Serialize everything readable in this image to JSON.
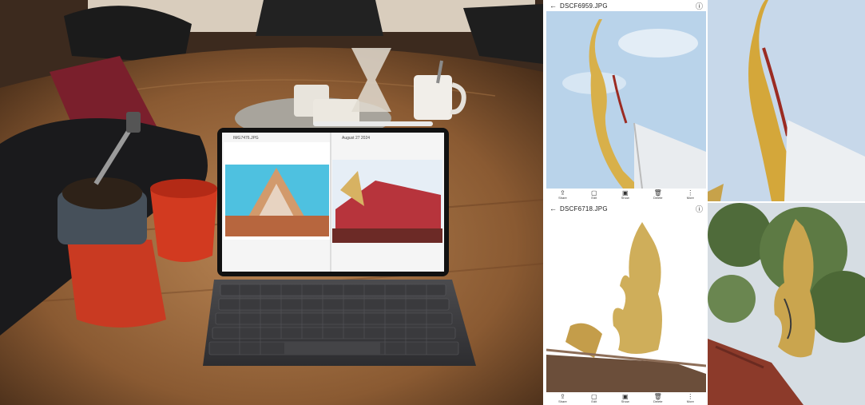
{
  "gallery": {
    "top": {
      "title": "DSCF6959.JPG",
      "back_icon": "arrow-left-icon",
      "info_icon": "info-icon",
      "toolbar": [
        {
          "icon": "share-icon",
          "label": "Share"
        },
        {
          "icon": "edit-icon",
          "label": "Edit"
        },
        {
          "icon": "screen-icon",
          "label": "Show"
        },
        {
          "icon": "delete-icon",
          "label": "Delete"
        },
        {
          "icon": "more-icon",
          "label": "More"
        }
      ]
    },
    "bottom": {
      "title": "DSCF6718.JPG",
      "back_icon": "arrow-left-icon",
      "info_icon": "info-icon",
      "toolbar": [
        {
          "icon": "share-icon",
          "label": "Share"
        },
        {
          "icon": "edit-icon",
          "label": "Edit"
        },
        {
          "icon": "screen-icon",
          "label": "Show"
        },
        {
          "icon": "delete-icon",
          "label": "Delete"
        },
        {
          "icon": "more-icon",
          "label": "More"
        }
      ]
    }
  },
  "tablet": {
    "left_title": "IMG7476.JPG",
    "right_title": "August 27 2024"
  },
  "colors": {
    "sky": "#b9d3ea",
    "gold": "#d8b04a",
    "table_wood": "#8a5a32",
    "roof_red": "#b5322a"
  }
}
